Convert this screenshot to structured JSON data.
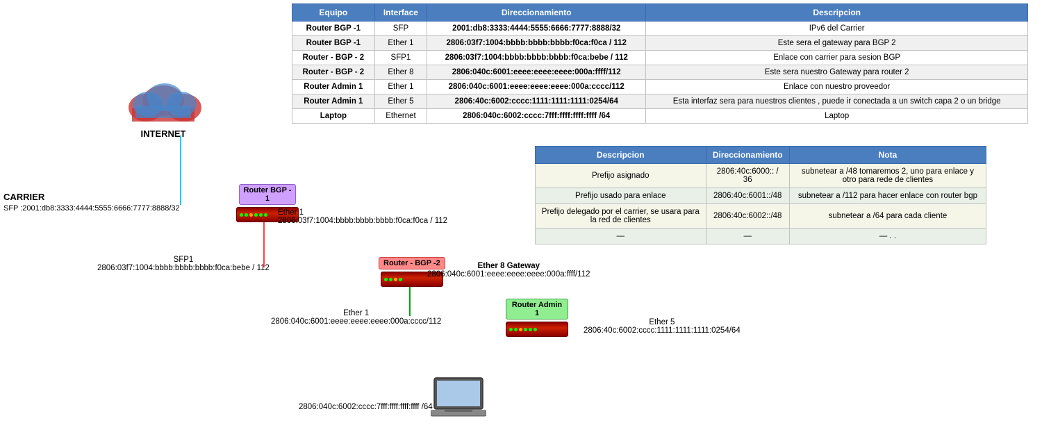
{
  "table": {
    "headers": [
      "Equipo",
      "Interface",
      "Direccionamiento",
      "Descripcion"
    ],
    "rows": [
      [
        "Router BGP -1",
        "SFP",
        "2001:db8:3333:4444:5555:6666:7777:8888/32",
        "IPv6 del Carrier"
      ],
      [
        "Router BGP -1",
        "Ether 1",
        "2806:03f7:1004:bbbb:bbbb:bbbb:f0ca:f0ca / 112",
        "Este sera el gateway para BGP 2"
      ],
      [
        "Router - BGP - 2",
        "SFP1",
        "2806:03f7:1004:bbbb:bbbb:bbbb:f0ca:bebe / 112",
        "Enlace con carrier para sesion BGP"
      ],
      [
        "Router - BGP - 2",
        "Ether 8",
        "2806:040c:6001:eeee:eeee:eeee:000a:ffff/112",
        "Este sera nuestro Gateway para router 2"
      ],
      [
        "Router Admin 1",
        "Ether 1",
        "2806:040c:6001:eeee:eeee:eeee:000a:cccc/112",
        "Enlace con nuestro proveedor"
      ],
      [
        "Router Admin 1",
        "Ether 5",
        "2806:40c:6002:cccc:1111:1111:1111:0254/64",
        "Esta interfaz sera para nuestros clientes , puede ir conectada a un switch capa 2 o un bridge"
      ],
      [
        "Laptop",
        "Ethernet",
        "2806:040c:6002:cccc:7fff:ffff:ffff:ffff /64",
        "Laptop"
      ]
    ]
  },
  "info_table": {
    "headers": [
      "Descripcion",
      "Direccionamiento",
      "Nota"
    ],
    "rows": [
      [
        "Prefijo asignado",
        "2806:40c:6000:: / 36",
        "subnetear a /48  tomaremos 2, uno para enlace y otro para rede de clientes"
      ],
      [
        "Prefijo usado para enlace",
        "2806:40c:6001::/48",
        "subnetear a /112 para hacer enlace con router bgp"
      ],
      [
        "Prefijo delegado por el carrier, se usara para la red de clientes",
        "2806:40c:6002::/48",
        "subnetear a /64 para cada cliente"
      ],
      [
        "—",
        "—",
        "— . ."
      ]
    ]
  },
  "diagram": {
    "internet_label": "INTERNET",
    "carrier_label": "CARRIER",
    "carrier_sfp": "SFP :2001:db8:3333:4444:5555:6666:7777:8888/32",
    "router_bgp1_label": "Router BGP -\n1",
    "router_bgp1_ether1": "Ether 1",
    "router_bgp1_addr": "2806:03f7:1004:bbbb:bbbb:bbbb:f0ca:f0ca / 112",
    "router_bgp2_label": "Router - BGP -2",
    "router_bgp2_sfp1": "SFP1",
    "router_bgp2_addr": "2806:03f7:1004:bbbb:bbbb:bbbb:f0ca:bebe / 112",
    "router_bgp2_ether8": "Ether 8 Gateway",
    "router_bgp2_ether8_addr": "2806:040c:6001:eeee:eeee:eeee:000a:ffff/112",
    "router_admin1_label": "Router Admin 1",
    "router_admin1_ether1": "Ether 1",
    "router_admin1_addr": "2806:040c:6001:eeee:eeee:eeee:000a:cccc/112",
    "router_admin1_ether5": "Ether 5",
    "router_admin1_ether5_addr": "2806:40c:6002:cccc:1111:1111:1111:0254/64",
    "laptop_addr": "2806:040c:6002:cccc:7fff:ffff:ffff:ffff /64"
  }
}
